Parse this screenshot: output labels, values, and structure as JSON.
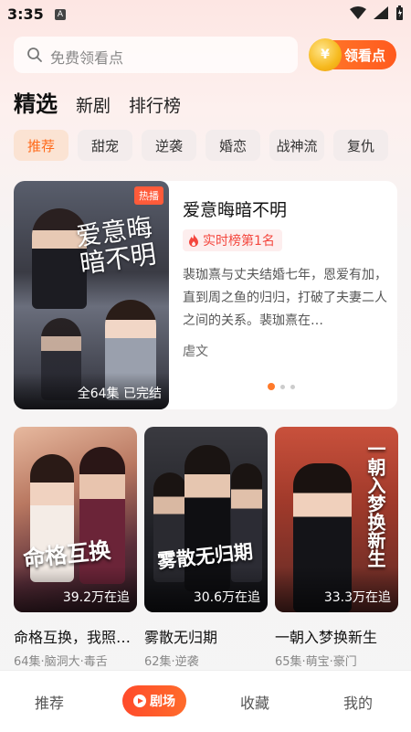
{
  "status_bar": {
    "time": "3:35",
    "notification_letter": "A"
  },
  "search": {
    "placeholder": "免费领看点"
  },
  "reward_button": {
    "label": "领看点",
    "coin_symbol": "¥"
  },
  "tabs": [
    {
      "label": "精选",
      "active": true
    },
    {
      "label": "新剧",
      "active": false
    },
    {
      "label": "排行榜",
      "active": false
    }
  ],
  "categories": [
    {
      "label": "推荐",
      "active": true
    },
    {
      "label": "甜宠",
      "active": false
    },
    {
      "label": "逆袭",
      "active": false
    },
    {
      "label": "婚恋",
      "active": false
    },
    {
      "label": "战神流",
      "active": false
    },
    {
      "label": "复仇",
      "active": false
    }
  ],
  "featured": {
    "title": "爱意晦暗不明",
    "poster_title": "爱意晦暗不明",
    "hot_tag": "热播",
    "rank": "实时榜第1名",
    "description": "裴珈熹与丈夫结婚七年，恩爱有加，直到周之鱼的归归，打破了夫妻二人之间的关系。裴珈熹在…",
    "tag": "虐文",
    "episodes": "全64集  已完结",
    "carousel_count": 3,
    "carousel_active": 0
  },
  "dramas": [
    {
      "title": "命格互换，我照…",
      "poster_title": "命格互换",
      "views": "39.2万在追",
      "meta": "64集·脑洞大·毒舌"
    },
    {
      "title": "雾散无归期",
      "poster_title": "雾散无归期",
      "views": "30.6万在追",
      "meta": "62集·逆袭"
    },
    {
      "title": "一朝入梦换新生",
      "poster_title": "一朝入梦换新生",
      "views": "33.3万在追",
      "meta": "65集·萌宝·豪门"
    }
  ],
  "bottom_nav": [
    {
      "label": "推荐",
      "active": false
    },
    {
      "label": "剧场",
      "active": true
    },
    {
      "label": "收藏",
      "active": false
    },
    {
      "label": "我的",
      "active": false
    }
  ],
  "colors": {
    "accent": "#ff6a1a",
    "rank_red": "#f4473e",
    "nav_pill": "#ff4b2b"
  }
}
